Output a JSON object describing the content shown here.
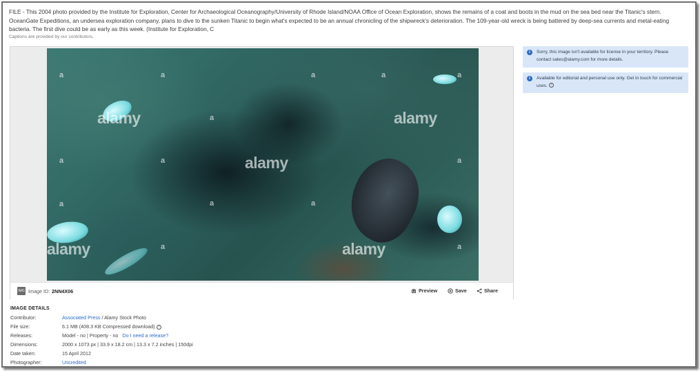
{
  "caption": {
    "text": "FILE - This 2004 photo provided by the Institute for Exploration, Center for Archaeological Oceanography/University of Rhode Island/NOAA Office of Ocean Exploration, shows the remains of a coat and boots in the mud on the sea bed near the Titanic's stern. OceanGate Expeditions, an undersea exploration company, plans to dive to the sunken Titanic to begin what's expected to be an annual chronicling of the shipwreck's deterioration. The 109-year-old wreck is being battered by deep-sea currents and metal-eating bacteria. The first dive could be as early as this week. (Institute for Exploration, C",
    "note": "Captions are provided by our contributors."
  },
  "viewer": {
    "watermark_big": "alamy",
    "watermark_small": "a",
    "image_id_label": "Image ID:",
    "image_id_value": "2NN4X06",
    "image_icon_text": "IMG",
    "actions": {
      "preview": "Preview",
      "save": "Save",
      "share": "Share"
    }
  },
  "notices": [
    {
      "text": "Sorry, this image isn't available for license in your territory. Please contact sales@alamy.com for more details.",
      "icon": "info-icon"
    },
    {
      "text": "Available for editorial and personal use only. Get in touch for commercial uses.",
      "icon": "info-icon"
    }
  ],
  "details": {
    "title": "IMAGE DETAILS",
    "contributor": {
      "label": "Contributor:",
      "link": "Associated Press",
      "rest": " / Alamy Stock Photo"
    },
    "file_size": {
      "label": "File size:",
      "value": "6.1 MB (408.3 KB Compressed download)"
    },
    "releases": {
      "label": "Releases:",
      "value": "Model - no | Property - no",
      "link": "Do I need a release?"
    },
    "dimensions": {
      "label": "Dimensions:",
      "value": "2000 x 1073 px | 33.9 x 18.2 cm | 13.3 x 7.2 inches | 150dpi"
    },
    "date_taken": {
      "label": "Date taken:",
      "value": "15 April 2012"
    },
    "photographer": {
      "label": "Photographer:",
      "link": "Uncredited"
    }
  },
  "colors": {
    "link": "#2d6ac6",
    "notice_bg": "#d8e6f7",
    "info_icon": "#2f6cc7"
  }
}
